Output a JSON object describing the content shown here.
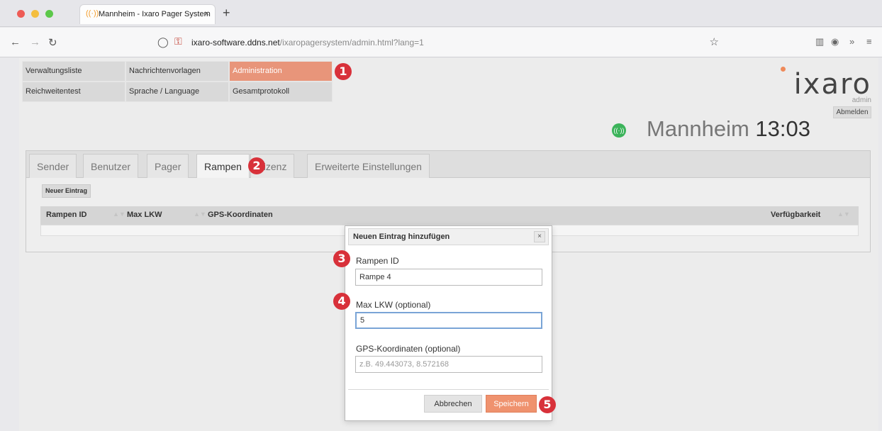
{
  "browser": {
    "tab_title": "Mannheim - Ixaro Pager System",
    "tab_close": "×",
    "new_tab": "+",
    "url_host": "ixaro-software.ddns.net",
    "url_path": "/ixaropagersystem/admin.html?lang=1"
  },
  "menu": {
    "items": [
      {
        "label": "Verwaltungsliste",
        "active": false
      },
      {
        "label": "Nachrichtenvorlagen",
        "active": false
      },
      {
        "label": "Administration",
        "active": true
      },
      {
        "label": "Reichweitentest",
        "active": false
      },
      {
        "label": "Sprache / Language",
        "active": false
      },
      {
        "label": "Gesamtprotokoll",
        "active": false
      }
    ]
  },
  "header": {
    "logo": "ixaro",
    "user_role": "admin",
    "logout_label": "Abmelden",
    "location": "Mannheim",
    "time": "13:03"
  },
  "tabs": [
    {
      "label": "Sender",
      "active": false
    },
    {
      "label": "Benutzer",
      "active": false
    },
    {
      "label": "Pager",
      "active": false
    },
    {
      "label": "Rampen",
      "active": true
    },
    {
      "label": "Lizenz",
      "active": false
    },
    {
      "label": "Erweiterte Einstellungen",
      "active": false
    }
  ],
  "toolbar": {
    "new_entry_label": "Neuer Eintrag"
  },
  "table": {
    "columns": [
      "Rampen ID",
      "Max LKW",
      "GPS-Koordinaten",
      "Verfügbarkeit"
    ]
  },
  "dialog": {
    "title": "Neuen Eintrag hinzufügen",
    "close": "×",
    "fields": {
      "rampen_id": {
        "label": "Rampen ID",
        "value": "Rampe 4"
      },
      "max_lkw": {
        "label": "Max LKW (optional)",
        "value": "5"
      },
      "gps": {
        "label": "GPS-Koordinaten (optional)",
        "placeholder": "z.B. 49.443073, 8.572168"
      }
    },
    "cancel_label": "Abbrechen",
    "save_label": "Speichern"
  },
  "callouts": [
    "1",
    "2",
    "3",
    "4",
    "5"
  ],
  "colors": {
    "accent": "#ef926e",
    "callout": "#d8313a",
    "online": "#3bb35a"
  }
}
